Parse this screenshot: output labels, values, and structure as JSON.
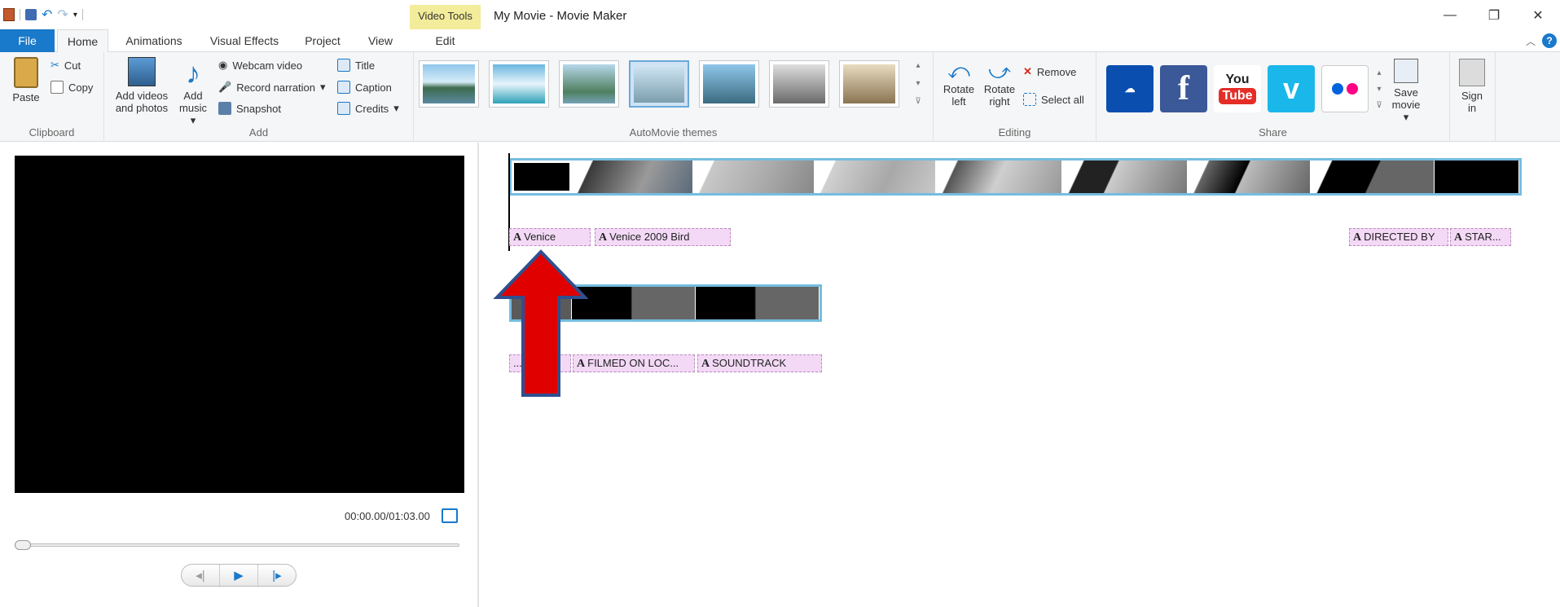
{
  "window": {
    "title": "My Movie - Movie Maker",
    "context_tab": "Video Tools"
  },
  "tabs": [
    "File",
    "Home",
    "Animations",
    "Visual Effects",
    "Project",
    "View",
    "Edit"
  ],
  "ribbon": {
    "clipboard": {
      "label": "Clipboard",
      "paste": "Paste",
      "cut": "Cut",
      "copy": "Copy"
    },
    "add": {
      "label": "Add",
      "add_videos": "Add videos",
      "and_photos": "and photos",
      "add": "Add",
      "music": "music",
      "webcam": "Webcam video",
      "narration": "Record narration",
      "snapshot": "Snapshot",
      "title": "Title",
      "caption": "Caption",
      "credits": "Credits"
    },
    "themes": {
      "label": "AutoMovie themes"
    },
    "editing": {
      "label": "Editing",
      "rotate_left_1": "Rotate",
      "rotate_left_2": "left",
      "rotate_right_1": "Rotate",
      "rotate_right_2": "right",
      "remove": "Remove",
      "select_all": "Select all"
    },
    "share": {
      "label": "Share",
      "youtube_1": "You",
      "youtube_2": "Tube",
      "save_1": "Save",
      "save_2": "movie",
      "sign_1": "Sign",
      "sign_2": "in"
    }
  },
  "preview": {
    "timecode": "00:00.00/01:03.00"
  },
  "captions_row1": [
    "Venice",
    "Venice 2009 Bird",
    "DIRECTED BY",
    "STAR..."
  ],
  "captions_row2": [
    "...",
    "FILMED ON LOC...",
    "SOUNDTRACK"
  ],
  "colors": {
    "accent": "#1979ca",
    "context": "#f3ec9a",
    "strip_border": "#74bde0",
    "caption_bg": "#f3d9f6",
    "arrow": "#e00000"
  }
}
